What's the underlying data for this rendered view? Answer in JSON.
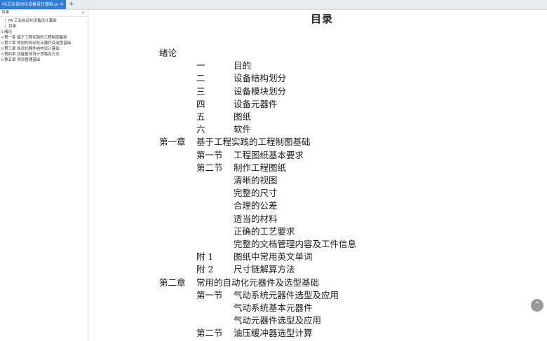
{
  "tab": {
    "label": "FA工业自动化设备设计基础.pdf",
    "close": "×",
    "add": "+"
  },
  "sidebar": {
    "title": "目录",
    "close": "×",
    "items": [
      {
        "label": "FA 工业自动化设备设计基础",
        "twisty": "",
        "level": 1
      },
      {
        "label": "目录",
        "twisty": "",
        "level": 1
      },
      {
        "label": "绪论",
        "twisty": "⊞",
        "level": 0
      },
      {
        "label": "第一章 基于工程实践的工程制图基础",
        "twisty": "⊞",
        "level": 0
      },
      {
        "label": "第二章 常用的自动化元器件及选型基础",
        "twisty": "⊞",
        "level": 0
      },
      {
        "label": "第三章 自动化器件结构设计基础",
        "twisty": "⊞",
        "level": 0
      },
      {
        "label": "第四章 设备整体设计思路及方法",
        "twisty": "⊞",
        "level": 0
      },
      {
        "label": "第五章 项目管理基础",
        "twisty": "⊞",
        "level": 0
      }
    ]
  },
  "document": {
    "title": "目录",
    "toc": [
      {
        "a": "绪论",
        "b": ""
      },
      {
        "a": "一",
        "b": "目的"
      },
      {
        "a": "二",
        "b": "设备结构划分"
      },
      {
        "a": "三",
        "b": "设备模块划分"
      },
      {
        "a": "四",
        "b": "设备元器件"
      },
      {
        "a": "五",
        "b": "图纸"
      },
      {
        "a": "六",
        "b": "软件"
      },
      {
        "a": "第一章",
        "b": "基于工程实践的工程制图基础"
      },
      {
        "a": "第一节",
        "b": "工程图纸基本要求"
      },
      {
        "a": "第二节",
        "b": "制作工程图纸"
      },
      {
        "a": "",
        "b": "清晰的视图"
      },
      {
        "a": "",
        "b": "完整的尺寸"
      },
      {
        "a": "",
        "b": "合理的公差"
      },
      {
        "a": "",
        "b": "适当的材料"
      },
      {
        "a": "",
        "b": "正确的工艺要求"
      },
      {
        "a": "",
        "b": "完整的文档管理内容及工件信息"
      },
      {
        "a": "附 1",
        "b": "图纸中常用英文单词"
      },
      {
        "a": "附 2",
        "b": "尺寸链解算方法"
      },
      {
        "a": "第二章",
        "b": "常用的自动化元器件及选型基础"
      },
      {
        "a": "第一节",
        "b": "气动系统元器件选型及应用"
      },
      {
        "a": "",
        "b": "气动系统基本元器件"
      },
      {
        "a": "",
        "b": "气动元器件选型及应用"
      },
      {
        "a": "第二节",
        "b": "油压缓冲器选型计算"
      }
    ]
  },
  "scroll_button": "⌃"
}
